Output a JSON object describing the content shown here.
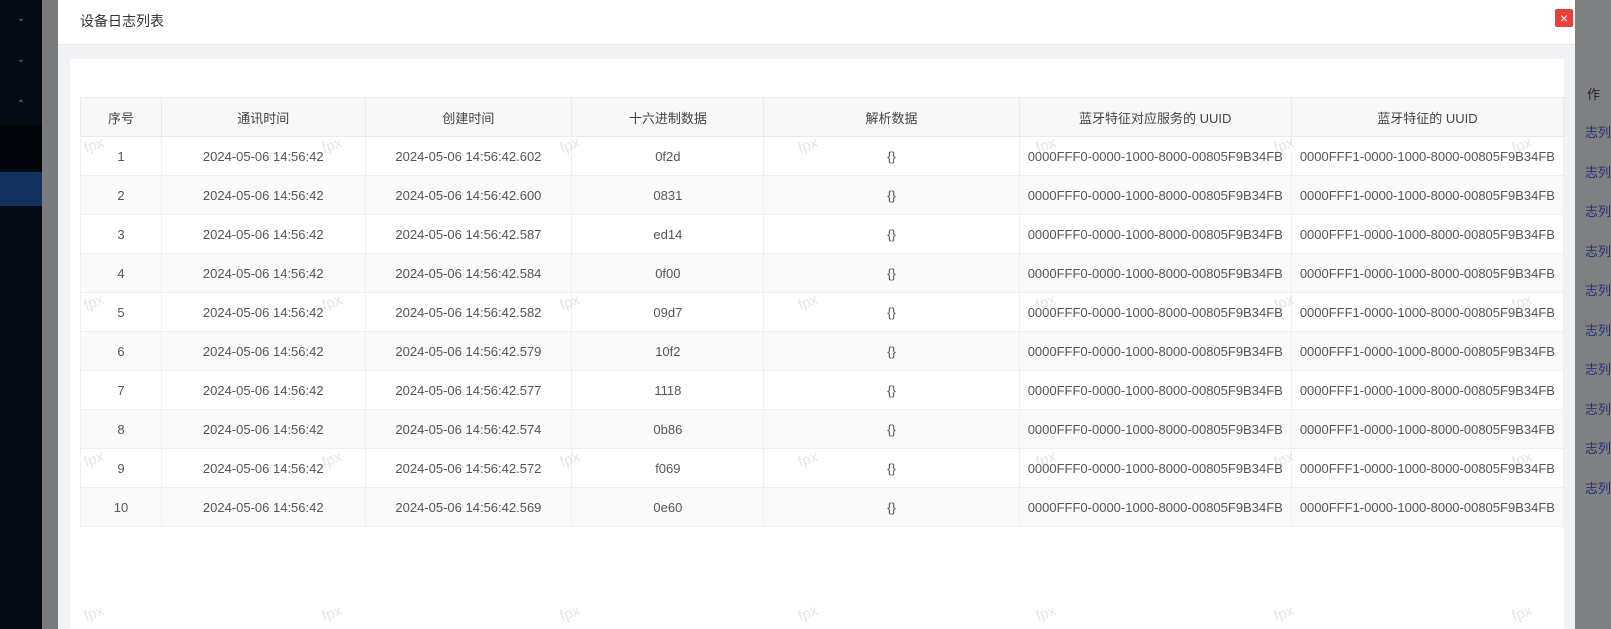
{
  "modal": {
    "title": "设备日志列表",
    "close_icon": "×"
  },
  "background": {
    "right_header": "作",
    "right_link": "志列表"
  },
  "watermark": "fpx",
  "table": {
    "columns": [
      "序号",
      "通讯时间",
      "创建时间",
      "十六进制数据",
      "解析数据",
      "蓝牙特征对应服务的 UUID",
      "蓝牙特征的 UUID"
    ],
    "rows": [
      [
        "1",
        "2024-05-06 14:56:42",
        "2024-05-06 14:56:42.602",
        "0f2d",
        "{}",
        "0000FFF0-0000-1000-8000-00805F9B34FB",
        "0000FFF1-0000-1000-8000-00805F9B34FB"
      ],
      [
        "2",
        "2024-05-06 14:56:42",
        "2024-05-06 14:56:42.600",
        "0831",
        "{}",
        "0000FFF0-0000-1000-8000-00805F9B34FB",
        "0000FFF1-0000-1000-8000-00805F9B34FB"
      ],
      [
        "3",
        "2024-05-06 14:56:42",
        "2024-05-06 14:56:42.587",
        "ed14",
        "{}",
        "0000FFF0-0000-1000-8000-00805F9B34FB",
        "0000FFF1-0000-1000-8000-00805F9B34FB"
      ],
      [
        "4",
        "2024-05-06 14:56:42",
        "2024-05-06 14:56:42.584",
        "0f00",
        "{}",
        "0000FFF0-0000-1000-8000-00805F9B34FB",
        "0000FFF1-0000-1000-8000-00805F9B34FB"
      ],
      [
        "5",
        "2024-05-06 14:56:42",
        "2024-05-06 14:56:42.582",
        "09d7",
        "{}",
        "0000FFF0-0000-1000-8000-00805F9B34FB",
        "0000FFF1-0000-1000-8000-00805F9B34FB"
      ],
      [
        "6",
        "2024-05-06 14:56:42",
        "2024-05-06 14:56:42.579",
        "10f2",
        "{}",
        "0000FFF0-0000-1000-8000-00805F9B34FB",
        "0000FFF1-0000-1000-8000-00805F9B34FB"
      ],
      [
        "7",
        "2024-05-06 14:56:42",
        "2024-05-06 14:56:42.577",
        "1118",
        "{}",
        "0000FFF0-0000-1000-8000-00805F9B34FB",
        "0000FFF1-0000-1000-8000-00805F9B34FB"
      ],
      [
        "8",
        "2024-05-06 14:56:42",
        "2024-05-06 14:56:42.574",
        "0b86",
        "{}",
        "0000FFF0-0000-1000-8000-00805F9B34FB",
        "0000FFF1-0000-1000-8000-00805F9B34FB"
      ],
      [
        "9",
        "2024-05-06 14:56:42",
        "2024-05-06 14:56:42.572",
        "f069",
        "{}",
        "0000FFF0-0000-1000-8000-00805F9B34FB",
        "0000FFF1-0000-1000-8000-00805F9B34FB"
      ],
      [
        "10",
        "2024-05-06 14:56:42",
        "2024-05-06 14:56:42.569",
        "0e60",
        "{}",
        "0000FFF0-0000-1000-8000-00805F9B34FB",
        "0000FFF1-0000-1000-8000-00805F9B34FB"
      ]
    ]
  },
  "colors": {
    "close_button": "#e8403b",
    "sidebar": "#050b14",
    "sidebar_active": "#1d4f9e"
  }
}
